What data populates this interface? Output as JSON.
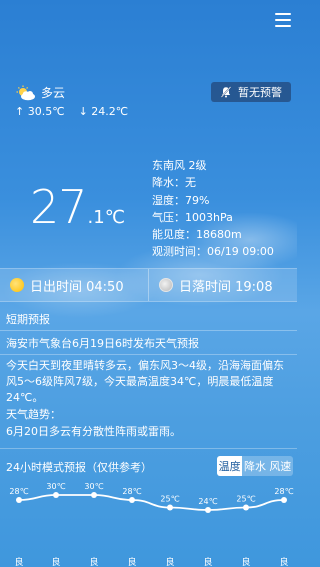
{
  "current": {
    "condition": "多云",
    "high": "↑ 30.5℃",
    "low": "↓ 24.2℃",
    "temp_int": "27",
    "temp_dec": ".1",
    "temp_unit": "℃"
  },
  "alert": {
    "label": "暂无预警"
  },
  "details": {
    "wind": "东南风 2级",
    "precip": "降水：无",
    "humidity": "湿度：79%",
    "pressure": "气压：1003hPa",
    "visibility": "能见度：18680m",
    "obs_time": "观测时间：06/19 09:00"
  },
  "sun": {
    "sunrise": "日出时间 04:50",
    "sunset": "日落时间 19:08"
  },
  "short_forecast": {
    "title": "短期预报",
    "line1": "海安市气象台6月19日6时发布天气预报",
    "line2": "今天白天到夜里晴转多云，偏东风3～4级，沿海海面偏东风5～6级阵风7级，今天最高温度34℃，明晨最低温度24℃。",
    "trend_label": "天气趋势：",
    "trend": "6月20日多云有分散性阵雨或雷雨。"
  },
  "model": {
    "title": "24小时模式预报（仅供参考）",
    "tabs": [
      "温度",
      "降水",
      "风速"
    ],
    "active_tab": 0
  },
  "chart_data": {
    "type": "line",
    "values": [
      28,
      30,
      30,
      28,
      25,
      24,
      25,
      28
    ],
    "labels": [
      "28℃",
      "30℃",
      "30℃",
      "28℃",
      "25℃",
      "24℃",
      "25℃",
      "28℃"
    ],
    "quality": [
      "良",
      "良",
      "良",
      "良",
      "良",
      "良",
      "良",
      "良"
    ]
  },
  "colors": {
    "active_tab_text": "#1f5d9e",
    "sun_yellow": "#ffc800"
  }
}
